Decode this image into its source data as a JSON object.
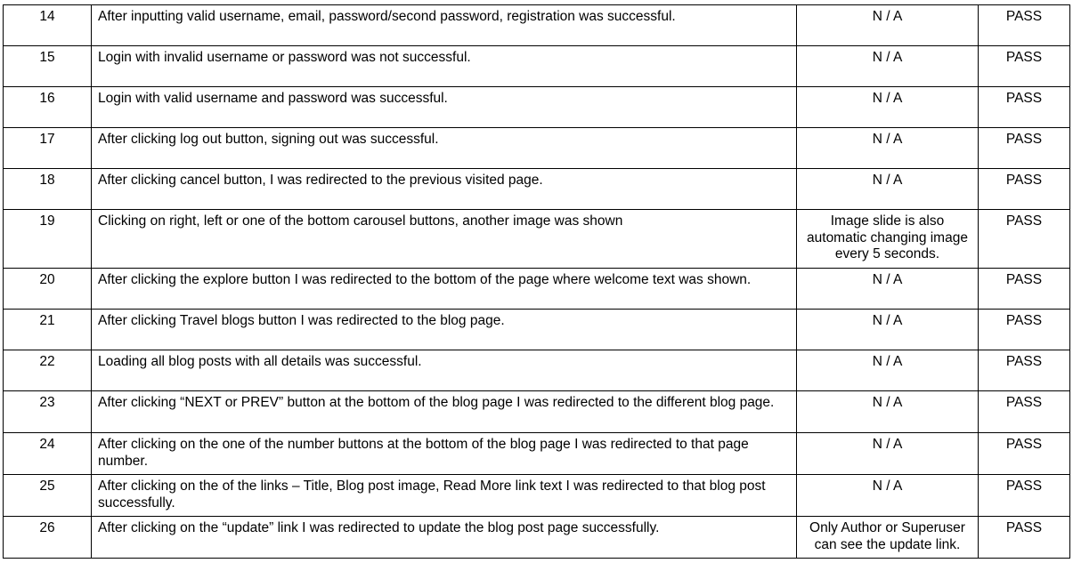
{
  "rows": [
    {
      "num": "14",
      "desc": "After inputting valid username, email, password/second password, registration was successful.",
      "note": "N / A",
      "result": "PASS"
    },
    {
      "num": "15",
      "desc": "Login with invalid username or password was not successful.",
      "note": "N / A",
      "result": "PASS"
    },
    {
      "num": "16",
      "desc": "Login with valid username and password was successful.",
      "note": "N / A",
      "result": "PASS"
    },
    {
      "num": "17",
      "desc": "After clicking log out button, signing out was successful.",
      "note": "N / A",
      "result": "PASS"
    },
    {
      "num": "18",
      "desc": "After clicking cancel button, I was redirected to the previous visited page.",
      "note": "N / A",
      "result": "PASS"
    },
    {
      "num": "19",
      "desc": "Clicking on right, left or one of the bottom carousel buttons, another image was shown",
      "note": "Image slide is also automatic changing image every 5 seconds.",
      "result": "PASS"
    },
    {
      "num": "20",
      "desc": "After clicking the explore button I was redirected to the bottom of the page where welcome text was shown.",
      "note": "N / A",
      "result": "PASS"
    },
    {
      "num": "21",
      "desc": "After clicking Travel blogs button I was redirected to the blog page.",
      "note": "N / A",
      "result": "PASS"
    },
    {
      "num": "22",
      "desc": "Loading all blog posts with all details was successful.",
      "note": "N / A",
      "result": "PASS"
    },
    {
      "num": "23",
      "desc": "After clicking “NEXT or PREV” button at the bottom of the blog page I was redirected to the different blog page.",
      "note": "N / A",
      "result": "PASS"
    },
    {
      "num": "24",
      "desc": "After clicking on the one of the number buttons at the bottom of the blog page I was redirected to that page number.",
      "note": "N / A",
      "result": "PASS"
    },
    {
      "num": "25",
      "desc": "After clicking on the of the links – Title, Blog post image, Read More link text I was redirected to that blog post successfully.",
      "note": "N / A",
      "result": "PASS"
    },
    {
      "num": "26",
      "desc": "After clicking on the “update” link I was redirected to update the blog post page successfully.",
      "note": "Only Author or Superuser can see the update link.",
      "result": "PASS"
    }
  ]
}
